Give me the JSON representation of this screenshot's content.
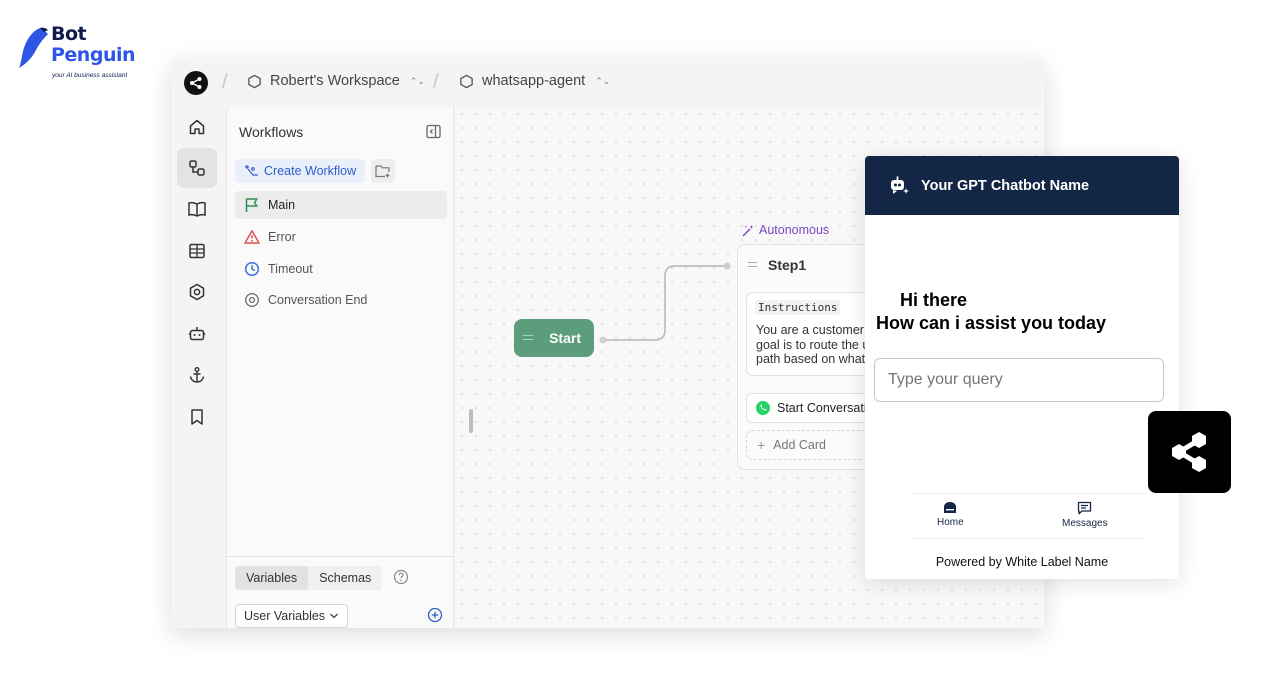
{
  "brand": {
    "name_line1": "Bot",
    "name_line2": "Penguin",
    "tagline": "your AI business assistant"
  },
  "topbar": {
    "workspace": "Robert's Workspace",
    "agent": "whatsapp-agent"
  },
  "rail": {
    "items": [
      "home-icon",
      "workflows-icon",
      "book-icon",
      "table-icon",
      "hexagon-icon",
      "bot-icon",
      "anchor-icon",
      "bookmark-icon"
    ],
    "active_index": 1
  },
  "sidepanel": {
    "title": "Workflows",
    "create_label": "Create Workflow",
    "items": [
      {
        "label": "Main",
        "icon": "flag-icon",
        "color": "#2f8f55"
      },
      {
        "label": "Error",
        "icon": "warning-icon",
        "color": "#d9534f"
      },
      {
        "label": "Timeout",
        "icon": "clock-icon",
        "color": "#3b6fd6"
      },
      {
        "label": "Conversation End",
        "icon": "stop-circle-icon",
        "color": "#777777"
      }
    ],
    "tabs": [
      "Variables",
      "Schemas"
    ],
    "active_tab": "Variables",
    "select_value": "User Variables"
  },
  "canvas": {
    "start_label": "Start",
    "autonomous_label": "Autonomous",
    "step_title": "Step1",
    "instructions_tag": "Instructions",
    "instructions_lines": [
      "You are a customer",
      "goal is to route the u",
      "path based on what"
    ],
    "start_conversation_label": "Start Conversati",
    "add_card_label": "Add Card"
  },
  "chat": {
    "bot_name": "Your GPT Chatbot Name",
    "greeting_line1": "Hi there",
    "greeting_line2": "How can i assist you today",
    "input_placeholder": "Type your query",
    "nav_home": "Home",
    "nav_messages": "Messages",
    "powered_by": "Powered by White Label Name",
    "header_color": "#142645"
  },
  "colors": {
    "accent_blue": "#2d5dc8",
    "start_green": "#5c9e7c",
    "autonomous_purple": "#7b47c4"
  }
}
